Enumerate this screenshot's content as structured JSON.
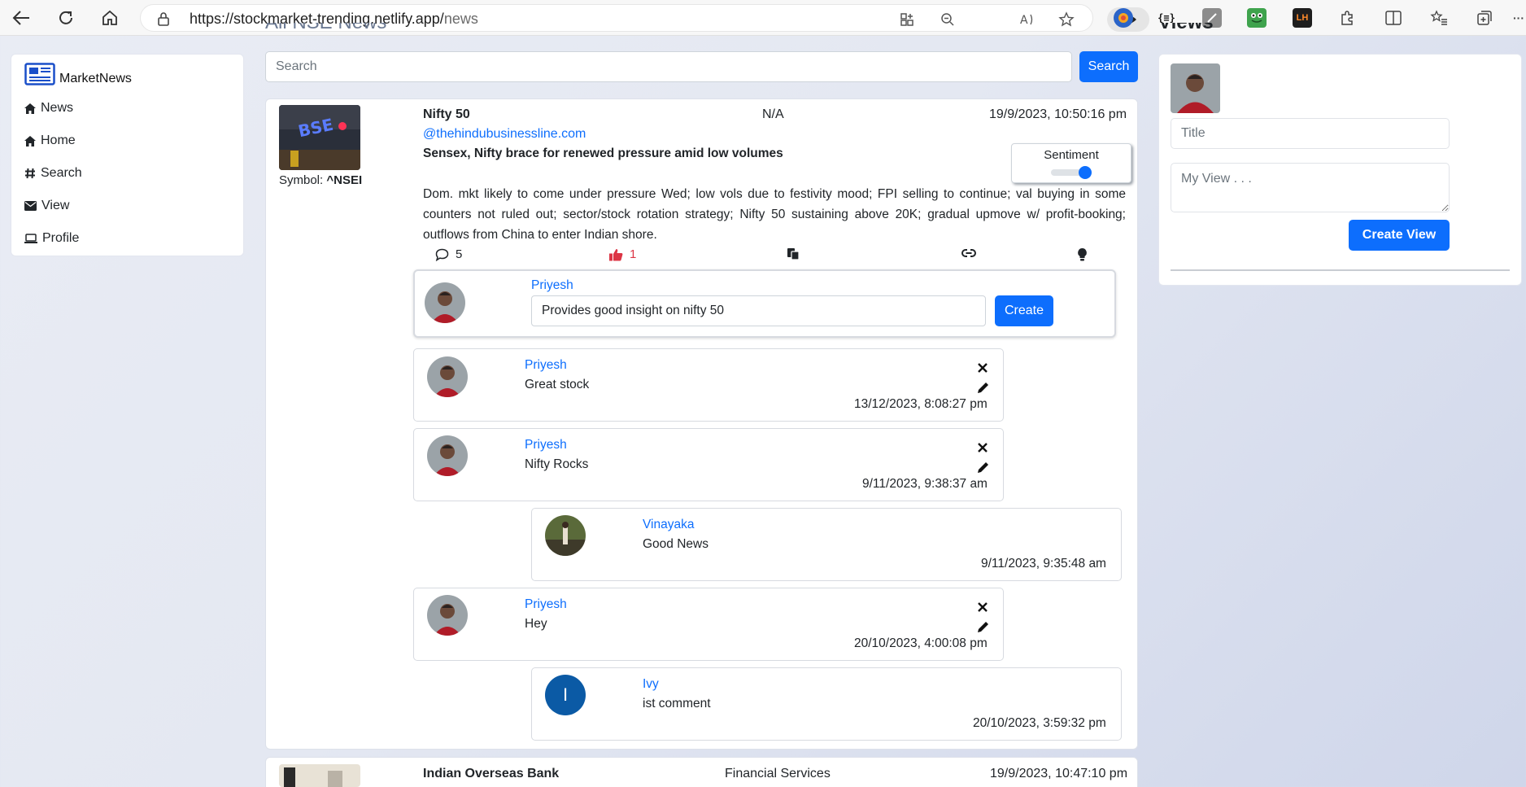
{
  "browser": {
    "url_host": "https://stockmarket-trending.netlify.app/",
    "url_path": "news"
  },
  "sidebar": {
    "brand": "MarketNews",
    "items": [
      {
        "label": "News",
        "icon": "home-icon"
      },
      {
        "label": "Home",
        "icon": "home-icon"
      },
      {
        "label": "Search",
        "icon": "hash-icon"
      },
      {
        "label": "View",
        "icon": "envelope-icon"
      },
      {
        "label": "Profile",
        "icon": "laptop-icon"
      }
    ]
  },
  "main": {
    "heading": "All NSE News",
    "search_placeholder": "Search",
    "search_button": "Search"
  },
  "news": [
    {
      "title": "Nifty 50",
      "sector": "N/A",
      "time": "19/9/2023, 10:50:16 pm",
      "source": "@thehindubusinessline.com",
      "headline": "Sensex, Nifty brace for renewed pressure amid low volumes",
      "summary": "Dom. mkt likely to come under pressure Wed; low vols due to festivity mood; FPI selling to continue; val buying in some counters not ruled out; sector/stock rotation strategy; Nifty 50 sustaining above 20K; gradual upmove w/ profit-booking; outflows from China to enter Indian shore.",
      "symbol_label": "Symbol:",
      "symbol": "^NSEI",
      "sentiment_label": "Sentiment",
      "sentiment_on": true,
      "comment_count": "5",
      "like_count": "1",
      "new_comment": {
        "author": "Priyesh",
        "value": "Provides good insight on nifty 50",
        "button": "Create"
      },
      "comments": [
        {
          "author": "Priyesh",
          "text": "Great stock",
          "time": "13/12/2023, 8:08:27 pm"
        },
        {
          "author": "Priyesh",
          "text": "Nifty Rocks",
          "time": "9/11/2023, 9:38:37 am"
        },
        {
          "author": "Vinayaka",
          "text": "Good News",
          "time": "9/11/2023, 9:35:48 am"
        },
        {
          "author": "Priyesh",
          "text": "Hey",
          "time": "20/10/2023, 4:00:08 pm"
        },
        {
          "author": "Ivy",
          "text": "ist comment",
          "time": "20/10/2023, 3:59:32 pm",
          "initial": "I"
        }
      ]
    },
    {
      "title": "Indian Overseas Bank",
      "sector": "Financial Services",
      "time": "19/9/2023, 10:47:10 pm"
    }
  ],
  "views_panel": {
    "heading": "Views",
    "title_placeholder": "Title",
    "view_placeholder": "My View . . .",
    "create_button": "Create View"
  },
  "colors": {
    "primary": "#0d6efd",
    "like": "#dc3545",
    "avatar_ivy": "#0b5aa5"
  }
}
